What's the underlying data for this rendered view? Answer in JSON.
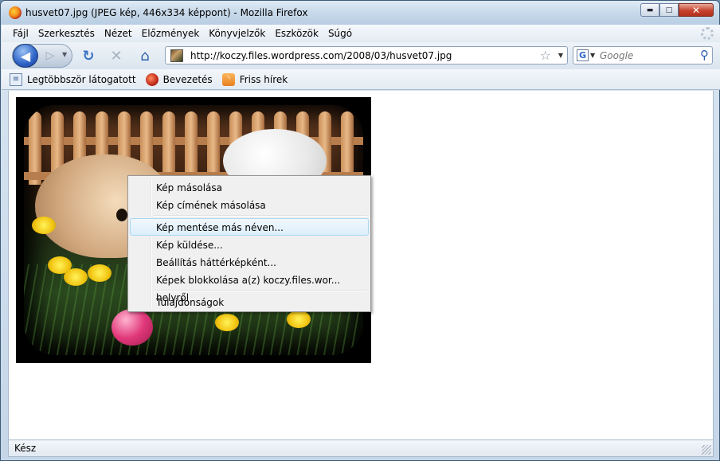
{
  "window": {
    "title": "husvet07.jpg (JPEG kép, 446x334 képpont) - Mozilla Firefox",
    "minimize_glyph": "▬",
    "maximize_glyph": "□",
    "close_glyph": "✕"
  },
  "menubar": {
    "items": [
      "Fájl",
      "Szerkesztés",
      "Nézet",
      "Előzmények",
      "Könyvjelzők",
      "Eszközök",
      "Súgó"
    ]
  },
  "navbar": {
    "back_glyph": "◀",
    "forward_glyph": "▷",
    "dropdown_glyph": "▼",
    "reload_glyph": "↻",
    "stop_glyph": "✕",
    "home_glyph": "⌂",
    "url": "http://koczy.files.wordpress.com/2008/03/husvet07.jpg",
    "bookmark_star_glyph": "☆",
    "search_engine_letter": "G",
    "search_placeholder": "Google",
    "search_go_glyph": "⚲"
  },
  "bookmarks": {
    "items": [
      {
        "label": "Legtöbbször látogatott",
        "icon": "smart-folder-icon",
        "glyph": "≡"
      },
      {
        "label": "Bevezetés",
        "icon": "firefox-bookmark-icon",
        "glyph": ""
      },
      {
        "label": "Friss hírek",
        "icon": "rss-icon",
        "glyph": "◝"
      }
    ]
  },
  "context_menu": {
    "items": [
      {
        "label": "Kép másolása",
        "highlighted": false
      },
      {
        "label": "Kép címének másolása",
        "highlighted": false
      },
      {
        "label": "Kép mentése más néven...",
        "highlighted": true
      },
      {
        "label": "Kép küldése...",
        "highlighted": false
      },
      {
        "label": "Beállítás háttérképként...",
        "highlighted": false
      },
      {
        "label": "Képek blokkolása a(z) koczy.files.wor... helyről",
        "highlighted": false
      },
      {
        "label": "Tulajdonságok",
        "highlighted": false
      }
    ]
  },
  "statusbar": {
    "text": "Kész"
  },
  "colors": {
    "highlight": "#dceefb",
    "titlebar": "#c8d9ea",
    "close_button": "#c7442e"
  }
}
